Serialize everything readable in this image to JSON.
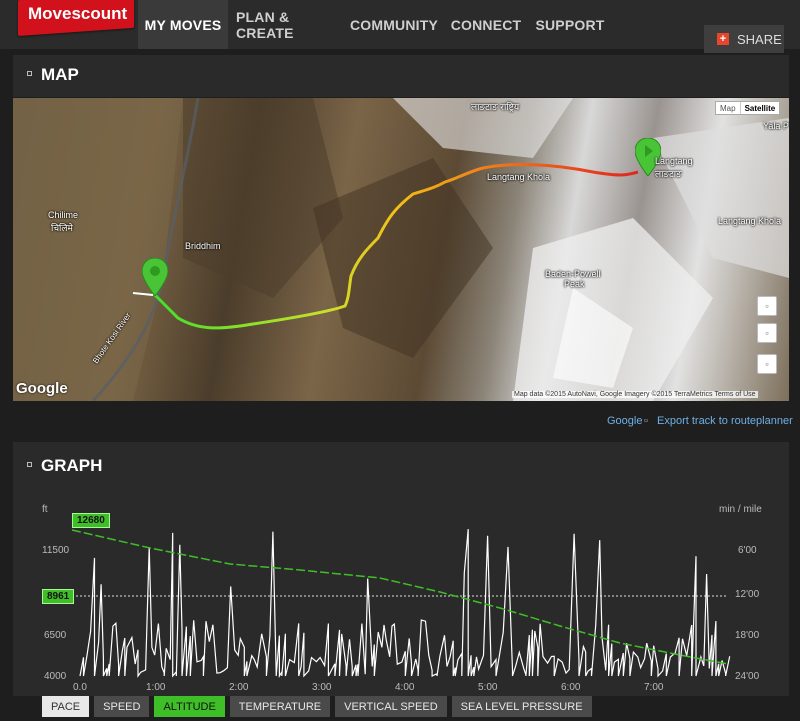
{
  "brand": {
    "logo_text": "Movescount",
    "logo_color": "#d1121c"
  },
  "nav": {
    "items": [
      {
        "label": "MY MOVES",
        "active": true
      },
      {
        "label": "PLAN & CREATE",
        "active": false
      },
      {
        "label": "COMMUNITY",
        "active": false
      },
      {
        "label": "CONNECT",
        "active": false
      },
      {
        "label": "SUPPORT",
        "active": false
      }
    ],
    "share_label": "SHARE",
    "share_icon": "+"
  },
  "map_section": {
    "title": "MAP",
    "map_type": {
      "map": "Map",
      "satellite": "Satellite",
      "selected": "Satellite"
    },
    "zoom_glyph": "▫",
    "labels": {
      "chilime": "Chilime",
      "chilime_native": "चिलिमे",
      "briddhim": "Briddhim",
      "langtang": "Langtang",
      "langtang_native": "लाङटाङ",
      "langtang_khola_1": "Langtang Khola",
      "langtang_khola_2": "Langtang Khola",
      "baden_powell": "Baden-Powell",
      "baden_powell_2": "Peak",
      "yala_peak": "Yala P",
      "top_native": "लाङटाङ राष्ट्रिय",
      "river_label": "Bhote Kosi River"
    },
    "google_logo": "Google",
    "attribution": "Map data ©2015 AutoNavi, Google Imagery ©2015 TerraMetrics   Terms of Use",
    "links": {
      "google": "Google",
      "export_icon": "▫",
      "export": "Export track to routeplanner"
    }
  },
  "graph_section": {
    "title": "GRAPH",
    "left_unit": "ft",
    "right_unit": "min / mile",
    "left_ticks": [
      "11500",
      "6500",
      "4000"
    ],
    "right_ticks": [
      "6'00",
      "12'00",
      "18'00",
      "24'00"
    ],
    "x_ticks": [
      "0.0",
      "1:00",
      "2:00",
      "3:00",
      "4:00",
      "5:00",
      "6:00",
      "7:00"
    ],
    "max_marker": "12680",
    "current_marker": "8961",
    "tabs": [
      {
        "label": "PACE",
        "style": "light"
      },
      {
        "label": "SPEED",
        "style": "dark"
      },
      {
        "label": "ALTITUDE",
        "style": "green"
      },
      {
        "label": "TEMPERATURE",
        "style": "dark"
      },
      {
        "label": "VERTICAL SPEED",
        "style": "dark"
      },
      {
        "label": "SEA LEVEL PRESSURE",
        "style": "dark"
      }
    ]
  },
  "colors": {
    "altitude": "#3fbf27",
    "pace": "#ffffff",
    "link": "#6fb0e6",
    "accent_red": "#d1121c"
  }
}
